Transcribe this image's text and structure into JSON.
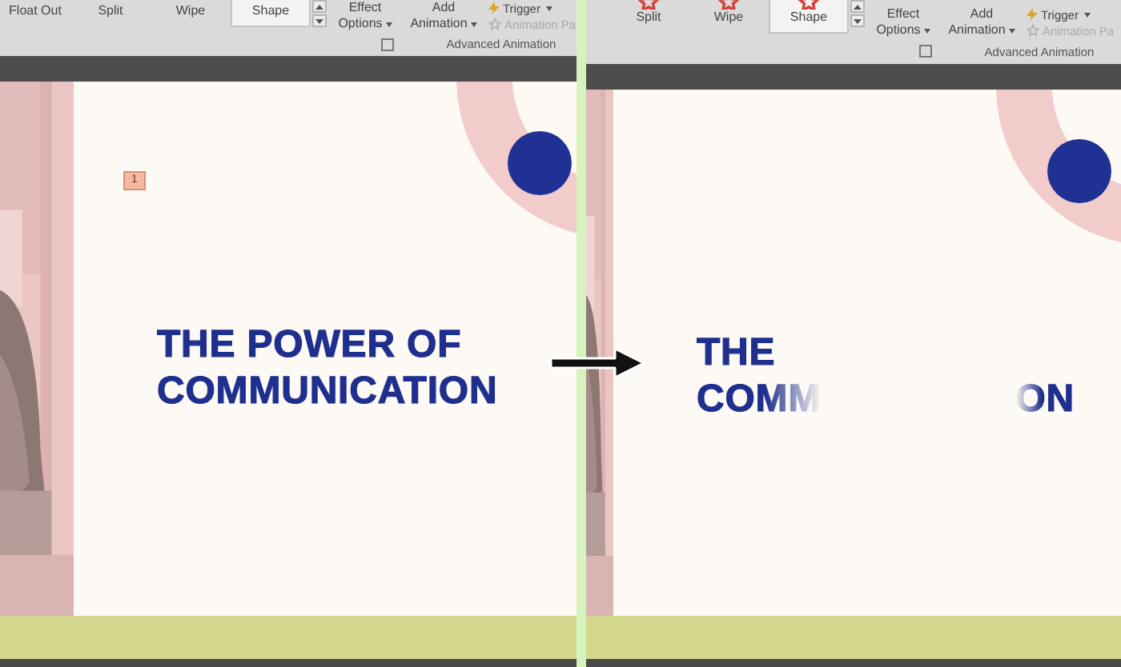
{
  "panels": [
    {
      "ribbon": {
        "gallery": [
          {
            "label": "Float Out",
            "selected": false
          },
          {
            "label": "Split",
            "selected": false
          },
          {
            "label": "Wipe",
            "selected": false
          },
          {
            "label": "Shape",
            "selected": true
          }
        ],
        "effect_options": {
          "line1": "Effect",
          "line2": "Options"
        },
        "add_animation": {
          "line1": "Add",
          "line2": "Animation"
        },
        "trigger": "Trigger",
        "animation_painter": {
          "label": "Animation Pa",
          "disabled": true
        },
        "group_label": "Advanced Animation"
      },
      "slide": {
        "badge": "1",
        "title_lines": [
          {
            "parts": [
              "THE POWER OF"
            ]
          },
          {
            "parts": [
              "COMMUNICATION"
            ]
          }
        ]
      }
    },
    {
      "ribbon": {
        "gallery": [
          {
            "label": "Split",
            "selected": false
          },
          {
            "label": "Wipe",
            "selected": false
          },
          {
            "label": "Shape",
            "selected": true
          }
        ],
        "effect_options": {
          "line1": "Effect",
          "line2": "Options"
        },
        "add_animation": {
          "line1": "Add",
          "line2": "Animation"
        },
        "trigger": "Trigger",
        "animation_painter": {
          "label": "Animation Pa",
          "disabled": true
        },
        "group_label": "Advanced Animation"
      },
      "slide": {
        "title_lines": [
          {
            "parts": [
              "THE"
            ]
          },
          {
            "parts": [
              "COMM",
              "ON"
            ]
          }
        ]
      }
    }
  ]
}
